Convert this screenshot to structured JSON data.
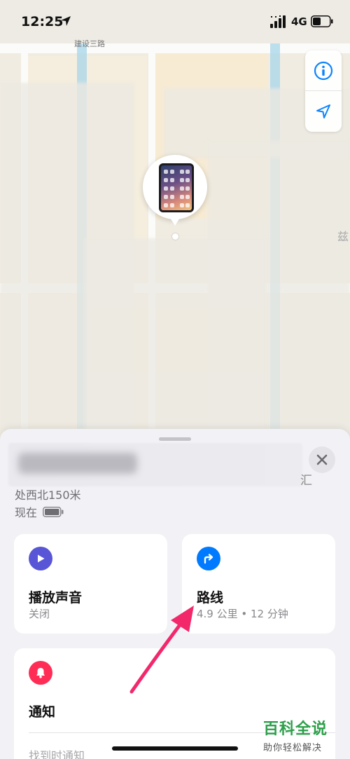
{
  "status_bar": {
    "time": "12:25",
    "network": "4G"
  },
  "map": {
    "street_label": "建设三路",
    "side_label": "兹"
  },
  "device": {
    "address_suffix": "汇",
    "distance": "处西北150米",
    "last_seen": "现在"
  },
  "actions": {
    "play_sound": {
      "title": "播放声音",
      "status": "关闭"
    },
    "route": {
      "title": "路线",
      "detail": "4.9 公里 • 12 分钟"
    },
    "notify": {
      "title": "通知",
      "option": "找到时通知"
    }
  },
  "watermark": {
    "title": "百科全说",
    "subtitle": "助你轻松解决"
  },
  "colors": {
    "sound_icon_bg": "#5856d6",
    "route_icon_bg": "#007aff",
    "notify_icon_bg": "#ff2d55",
    "map_button": "#0a84ff",
    "annotation_arrow": "#f2286b",
    "watermark_green": "#2ca04a"
  }
}
